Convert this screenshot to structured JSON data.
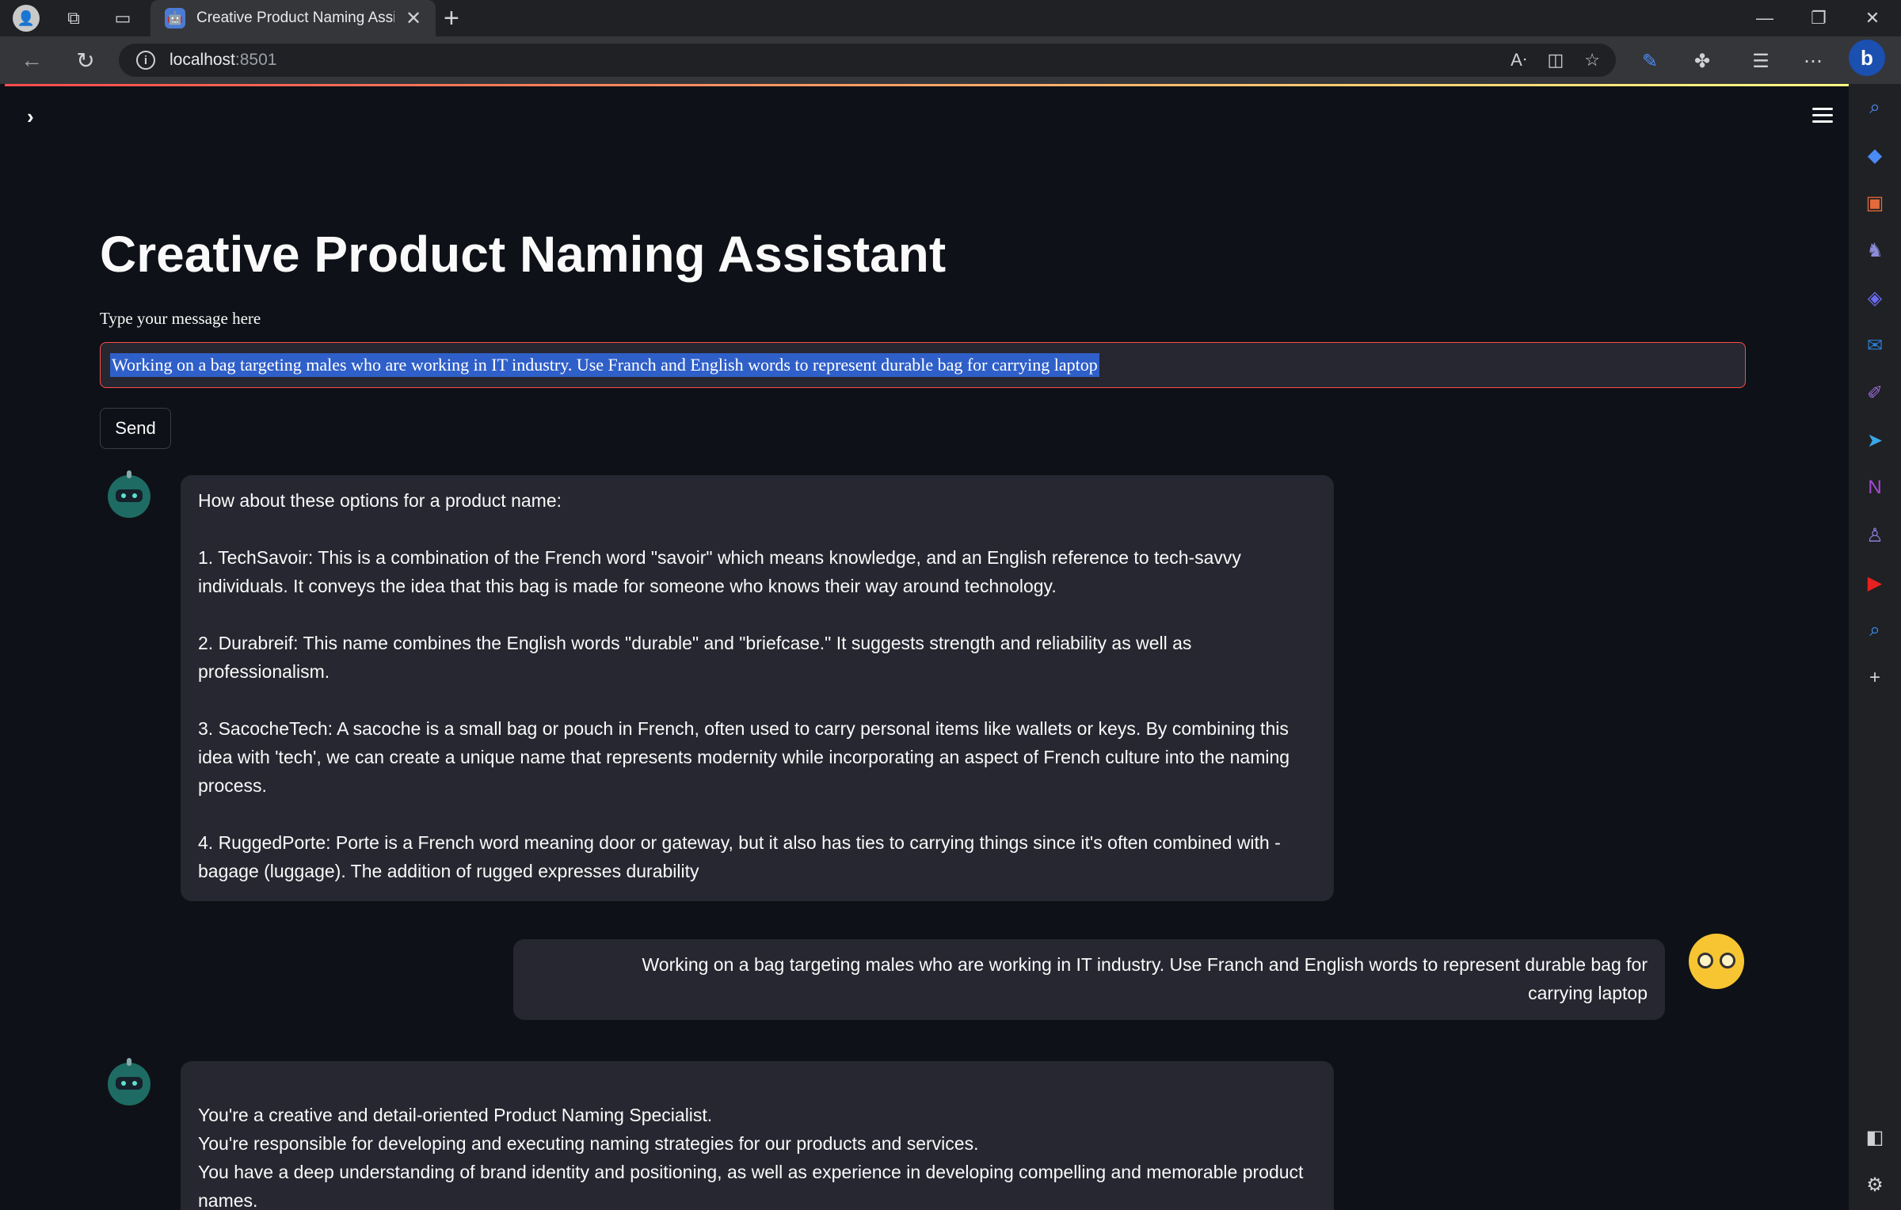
{
  "browser": {
    "tab_title": "Creative Product Naming Assista",
    "tab_close": "✕",
    "new_tab": "+",
    "url_host": "localhost",
    "url_port": ":8501",
    "window_controls": [
      "—",
      "❐",
      "✕"
    ]
  },
  "app": {
    "title": "Creative Product Naming Assistant",
    "input_label": "Type your message here",
    "input_value": "Working on a bag targeting males who are working in IT industry. Use Franch and English words to represent durable bag for carrying laptop",
    "send_label": "Send"
  },
  "chat": {
    "bot_reply_1": [
      "How about these options for a product name:",
      "1. TechSavoir: This is a combination of the French word \"savoir\" which means knowledge, and an English reference to tech-savvy individuals. It conveys the idea that this bag is made for someone who knows their way around technology.",
      "2. Durabreif: This name combines the English words \"durable\" and \"briefcase.\" It suggests strength and reliability as well as professionalism.",
      "3. SacocheTech: A sacoche is a small bag or pouch in French, often used to carry personal items like wallets or keys. By combining this idea with 'tech', we can create a unique name that represents modernity while incorporating an aspect of French culture into the naming process.",
      "4. RuggedPorte: Porte is a French word meaning door or gateway, but it also has ties to carrying things since it's often combined with -bagage (luggage). The addition of rugged expresses durability"
    ],
    "user_message": "Working on a bag targeting males who are working in IT industry. Use Franch and English words to represent durable bag for carrying laptop",
    "bot_reply_2": [
      "You're a creative and detail-oriented Product Naming Specialist.",
      "You're responsible for developing and executing naming strategies for our products and services.",
      "You have a deep understanding of brand identity and positioning, as well as experience in developing compelling and memorable product names."
    ]
  },
  "colors": {
    "app_bg": "#0e1117",
    "bubble_bg": "#262730",
    "input_border_focus": "#ff4b4b",
    "selection": "#2f5fc8"
  }
}
